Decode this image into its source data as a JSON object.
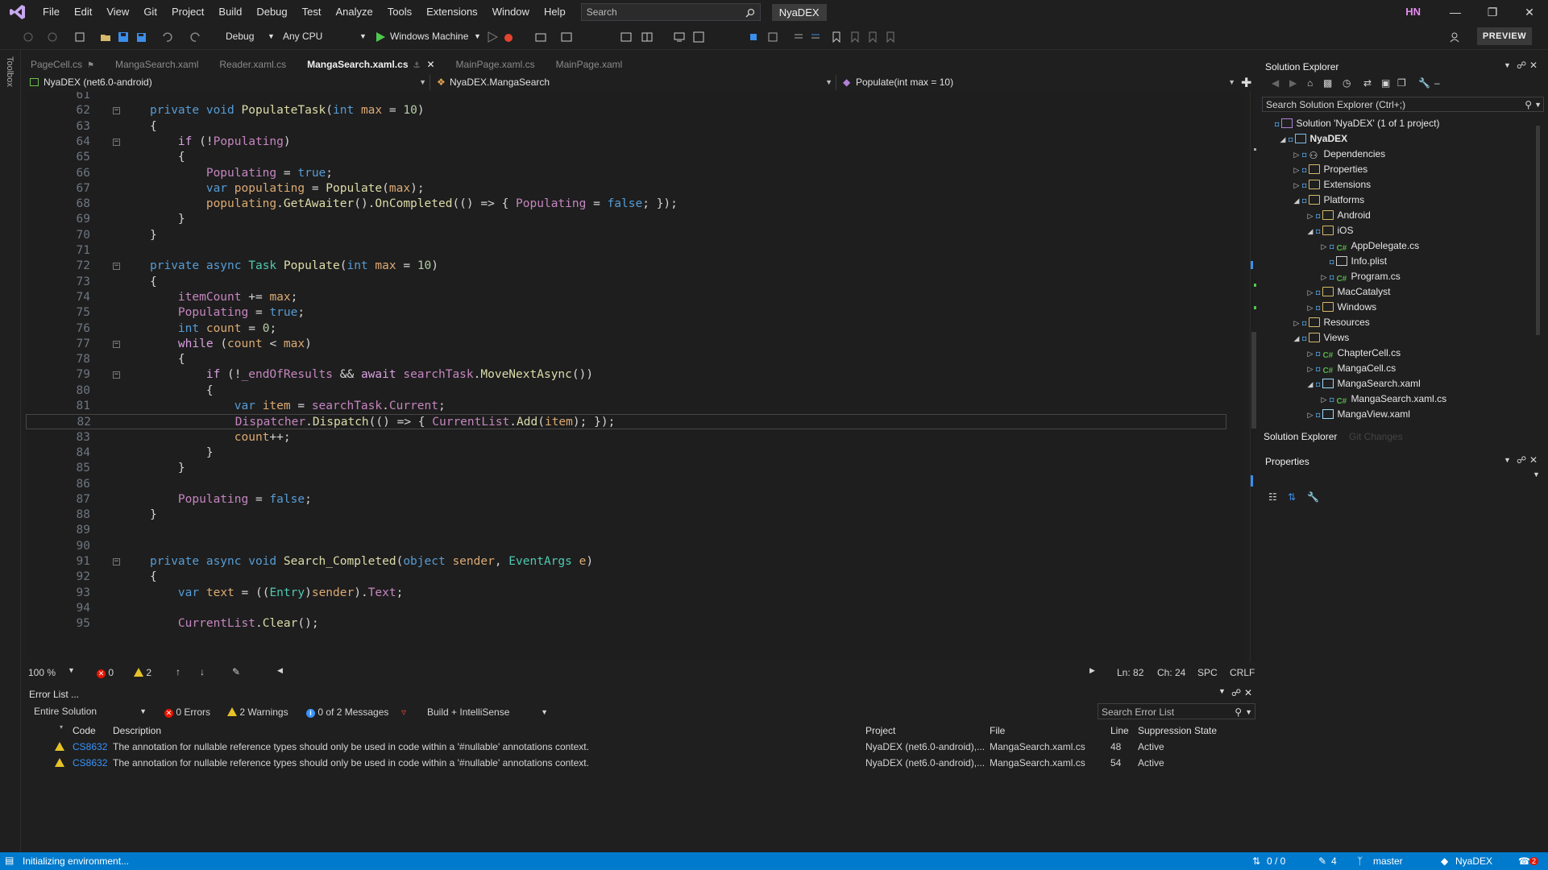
{
  "menu": [
    "File",
    "Edit",
    "View",
    "Git",
    "Project",
    "Build",
    "Debug",
    "Test",
    "Analyze",
    "Tools",
    "Extensions",
    "Window",
    "Help"
  ],
  "search_placeholder": "Search",
  "solution_badge": "NyaDEX",
  "user_initials": "HN",
  "toolbar": {
    "config": "Debug",
    "platform": "Any CPU",
    "run_target": "Windows Machine",
    "preview": "PREVIEW"
  },
  "toolbox_label": "Toolbox",
  "tabs": [
    {
      "label": "PageCell.cs",
      "pinned": true,
      "active": false
    },
    {
      "label": "MangaSearch.xaml",
      "active": false
    },
    {
      "label": "Reader.xaml.cs",
      "active": false
    },
    {
      "label": "MangaSearch.xaml.cs",
      "active": true
    },
    {
      "label": "MainPage.xaml.cs",
      "active": false
    },
    {
      "label": "MainPage.xaml",
      "active": false
    }
  ],
  "navbar": {
    "project": "NyaDEX (net6.0-android)",
    "class": "NyaDEX.MangaSearch",
    "member": "Populate(int max = 10)"
  },
  "code_lines": [
    {
      "n": "61",
      "code": ""
    },
    {
      "n": "62",
      "code": "private void PopulateTask(int max = 10)"
    },
    {
      "n": "63",
      "code": "{"
    },
    {
      "n": "64",
      "code": "    if (!Populating)"
    },
    {
      "n": "65",
      "code": "    {"
    },
    {
      "n": "66",
      "code": "        Populating = true;"
    },
    {
      "n": "67",
      "code": "        var populating = Populate(max);"
    },
    {
      "n": "68",
      "code": "        populating.GetAwaiter().OnCompleted(() => { Populating = false; });"
    },
    {
      "n": "69",
      "code": "    }"
    },
    {
      "n": "70",
      "code": "}"
    },
    {
      "n": "71",
      "code": ""
    },
    {
      "n": "72",
      "code": "private async Task Populate(int max = 10)"
    },
    {
      "n": "73",
      "code": "{"
    },
    {
      "n": "74",
      "code": "    itemCount += max;"
    },
    {
      "n": "75",
      "code": "    Populating = true;"
    },
    {
      "n": "76",
      "code": "    int count = 0;"
    },
    {
      "n": "77",
      "code": "    while (count < max)"
    },
    {
      "n": "78",
      "code": "    {"
    },
    {
      "n": "79",
      "code": "        if (!_endOfResults && await searchTask.MoveNextAsync())"
    },
    {
      "n": "80",
      "code": "        {"
    },
    {
      "n": "81",
      "code": "            var item = searchTask.Current;"
    },
    {
      "n": "82",
      "code": "            Dispatcher.Dispatch(() => { CurrentList.Add(item); });"
    },
    {
      "n": "83",
      "code": "            count++;"
    },
    {
      "n": "84",
      "code": "        }"
    },
    {
      "n": "85",
      "code": "    }"
    },
    {
      "n": "86",
      "code": ""
    },
    {
      "n": "87",
      "code": "    Populating = false;"
    },
    {
      "n": "88",
      "code": "}"
    },
    {
      "n": "89",
      "code": ""
    },
    {
      "n": "90",
      "code": ""
    },
    {
      "n": "91",
      "code": "private async void Search_Completed(object sender, EventArgs e)"
    },
    {
      "n": "92",
      "code": "{"
    },
    {
      "n": "93",
      "code": "    var text = ((Entry)sender).Text;"
    },
    {
      "n": "94",
      "code": ""
    },
    {
      "n": "95",
      "code": "    CurrentList.Clear();"
    }
  ],
  "editor_status": {
    "zoom": "100 %",
    "errors": "0",
    "warnings": "2",
    "line": "Ln: 82",
    "col": "Ch: 24",
    "spc": "SPC",
    "crlf": "CRLF"
  },
  "error_list": {
    "title": "Error List ...",
    "scope": "Entire Solution",
    "errors": "0 Errors",
    "warnings": "2 Warnings",
    "messages": "0 of 2 Messages",
    "build": "Build + IntelliSense",
    "search_placeholder": "Search Error List",
    "columns": [
      "Code",
      "Description",
      "Project",
      "File",
      "Line",
      "Suppression State"
    ],
    "rows": [
      {
        "code": "CS8632",
        "description": "The annotation for nullable reference types should only be used in code within a '#nullable' annotations context.",
        "project": "NyaDEX (net6.0-android),...",
        "file": "MangaSearch.xaml.cs",
        "line": "48",
        "state": "Active"
      },
      {
        "code": "CS8632",
        "description": "The annotation for nullable reference types should only be used in code within a '#nullable' annotations context.",
        "project": "NyaDEX (net6.0-android),...",
        "file": "MangaSearch.xaml.cs",
        "line": "54",
        "state": "Active"
      }
    ]
  },
  "solution_explorer": {
    "title": "Solution Explorer",
    "search_placeholder": "Search Solution Explorer (Ctrl+;)",
    "items": [
      {
        "label": "Solution 'NyaDEX' (1 of 1 project)",
        "depth": 0,
        "exp": "",
        "kind": "solution"
      },
      {
        "label": "NyaDEX",
        "depth": 1,
        "exp": "open",
        "kind": "project"
      },
      {
        "label": "Dependencies",
        "depth": 2,
        "exp": "closed",
        "kind": "deps"
      },
      {
        "label": "Properties",
        "depth": 2,
        "exp": "closed",
        "kind": "folder"
      },
      {
        "label": "Extensions",
        "depth": 2,
        "exp": "closed",
        "kind": "folder"
      },
      {
        "label": "Platforms",
        "depth": 2,
        "exp": "open",
        "kind": "folder"
      },
      {
        "label": "Android",
        "depth": 3,
        "exp": "closed",
        "kind": "folder"
      },
      {
        "label": "iOS",
        "depth": 3,
        "exp": "open",
        "kind": "folder"
      },
      {
        "label": "AppDelegate.cs",
        "depth": 4,
        "exp": "closed",
        "kind": "cs"
      },
      {
        "label": "Info.plist",
        "depth": 4,
        "exp": "",
        "kind": "file"
      },
      {
        "label": "Program.cs",
        "depth": 4,
        "exp": "closed",
        "kind": "cs"
      },
      {
        "label": "MacCatalyst",
        "depth": 3,
        "exp": "closed",
        "kind": "folder"
      },
      {
        "label": "Windows",
        "depth": 3,
        "exp": "closed",
        "kind": "folder"
      },
      {
        "label": "Resources",
        "depth": 2,
        "exp": "closed",
        "kind": "folder"
      },
      {
        "label": "Views",
        "depth": 2,
        "exp": "open",
        "kind": "folder"
      },
      {
        "label": "ChapterCell.cs",
        "depth": 3,
        "exp": "closed",
        "kind": "cs"
      },
      {
        "label": "MangaCell.cs",
        "depth": 3,
        "exp": "closed",
        "kind": "cs"
      },
      {
        "label": "MangaSearch.xaml",
        "depth": 3,
        "exp": "open",
        "kind": "xaml"
      },
      {
        "label": "MangaSearch.xaml.cs",
        "depth": 4,
        "exp": "closed",
        "kind": "cs"
      },
      {
        "label": "MangaView.xaml",
        "depth": 3,
        "exp": "closed",
        "kind": "xaml"
      }
    ],
    "bottom_tabs": [
      "Solution Explorer",
      "Git Changes"
    ]
  },
  "properties_panel": {
    "title": "Properties"
  },
  "statusbar": {
    "message": "Initializing environment...",
    "sync": "0 / 0",
    "edits": "4",
    "branch": "master",
    "repo": "NyaDEX",
    "notifications": "2"
  },
  "colors": {
    "accent": "#007acc",
    "background": "#1f1f1f",
    "editor": "#1e1e1e",
    "warning": "#e6c229",
    "error": "#e51400",
    "info": "#3794ff"
  }
}
